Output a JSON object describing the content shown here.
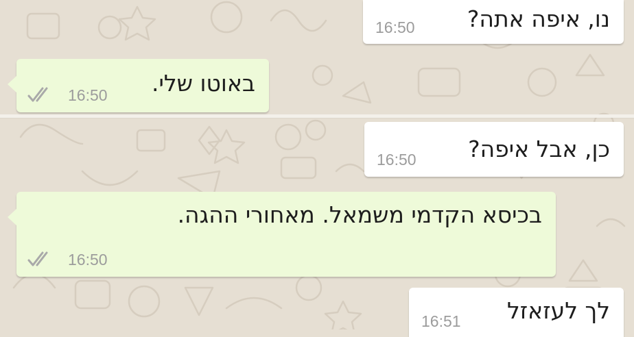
{
  "messages": [
    {
      "text": "נו, איפה אתה?",
      "time": "16:50",
      "direction": "incoming"
    },
    {
      "text": "באוטו שלי.",
      "time": "16:50",
      "direction": "outgoing",
      "status_icon": "double-check-icon"
    },
    {
      "text": "כן, אבל איפה?",
      "time": "16:50",
      "direction": "incoming"
    },
    {
      "text": "בכיסא הקדמי משמאל. מאחורי ההגה.",
      "time": "16:50",
      "direction": "outgoing",
      "status_icon": "double-check-icon"
    },
    {
      "text": "לך לעזאזל",
      "time": "16:51",
      "direction": "incoming"
    }
  ],
  "colors": {
    "wallpaper": "#e6dfd3",
    "incoming_bubble": "#ffffff",
    "outgoing_bubble": "#eefad9",
    "text": "#1d1d1d",
    "time": "#9c9c9c"
  }
}
